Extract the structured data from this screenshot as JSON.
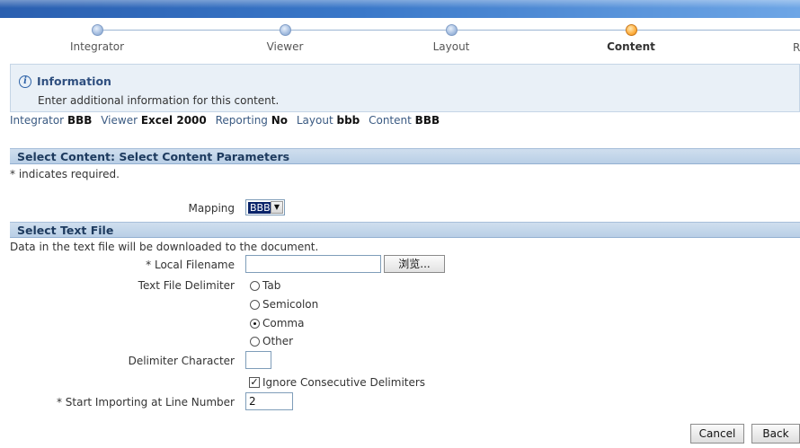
{
  "train": {
    "steps": [
      {
        "label": "Integrator",
        "state": "visited"
      },
      {
        "label": "Viewer",
        "state": "visited"
      },
      {
        "label": "Layout",
        "state": "visited"
      },
      {
        "label": "Content",
        "state": "active"
      },
      {
        "label": "R",
        "state": "upcoming"
      }
    ]
  },
  "info": {
    "title": "Information",
    "message": "Enter additional information for this content."
  },
  "summary": [
    {
      "key": "Integrator",
      "value": "BBB"
    },
    {
      "key": "Viewer",
      "value": "Excel 2000"
    },
    {
      "key": "Reporting",
      "value": "No"
    },
    {
      "key": "Layout",
      "value": "bbb"
    },
    {
      "key": "Content",
      "value": "BBB"
    }
  ],
  "content_section": {
    "title": "Select Content: Select Content Parameters",
    "required_note": "* indicates required.",
    "mapping_label": "Mapping",
    "mapping_value": "BBB"
  },
  "text_file_section": {
    "title": "Select Text File",
    "description": "Data in the text file will be downloaded to the document.",
    "local_filename_label": "* Local Filename",
    "local_filename_value": "",
    "browse_label": "浏览...",
    "delimiter_label": "Text File Delimiter",
    "delimiter_options": [
      {
        "label": "Tab",
        "selected": false
      },
      {
        "label": "Semicolon",
        "selected": false
      },
      {
        "label": "Comma",
        "selected": true
      },
      {
        "label": "Other",
        "selected": false
      }
    ],
    "delimiter_char_label": "Delimiter Character",
    "delimiter_char_value": "",
    "ignore_consecutive_label": "Ignore Consecutive Delimiters",
    "ignore_consecutive_checked": true,
    "start_line_label": "* Start Importing at Line Number",
    "start_line_value": "2"
  },
  "buttons": {
    "cancel": "Cancel",
    "back": "Back"
  }
}
